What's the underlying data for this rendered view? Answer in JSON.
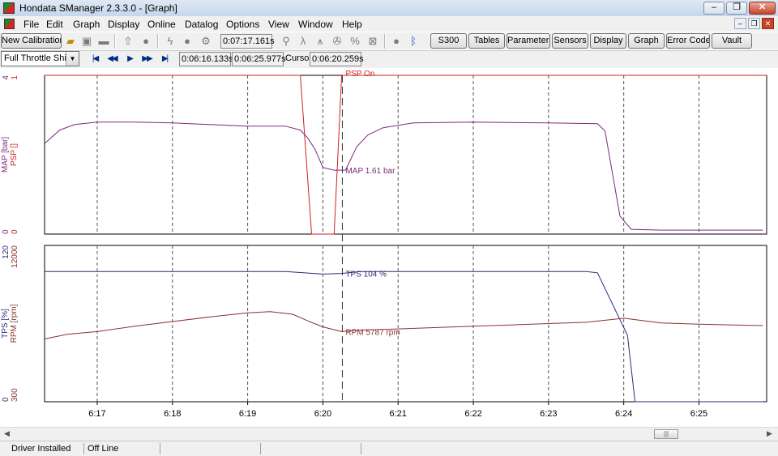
{
  "window": {
    "title": "Hondata SManager 2.3.3.0 - [Graph]"
  },
  "menu": [
    "File",
    "Edit",
    "Graph",
    "Display",
    "Online",
    "Datalog",
    "Options",
    "View",
    "Window",
    "Help"
  ],
  "toolbar1": {
    "new_calibration": "New Calibration",
    "elapsed": "0:07:17.161s",
    "buttons": [
      "S300",
      "Tables",
      "Parameters",
      "Sensors",
      "Display",
      "Graph",
      "Error Codes",
      "Vault"
    ]
  },
  "toolbar2": {
    "preset": "Full Throttle Shift",
    "start_time": "0:06:16.133s",
    "end_time": "0:06:25.977s",
    "cursor_label": "Cursor",
    "cursor_time": "0:06:20.259s"
  },
  "statusbar": [
    "Driver Installed",
    "Off Line"
  ],
  "colors": {
    "psp": "#cc2222",
    "map": "#7a2a7a",
    "tps": "#2b2b7a",
    "rpm": "#8a3030",
    "grid": "#555555"
  },
  "chart_data": {
    "type": "line",
    "x_unit": "time (m:ss)",
    "xlim": [
      6.163,
      6.259
    ],
    "x_ticks": [
      "6:17",
      "6:18",
      "6:19",
      "6:20",
      "6:21",
      "6:22",
      "6:23",
      "6:24",
      "6:25"
    ],
    "cursor_x": "6:20.259",
    "panels": [
      {
        "name": "top",
        "axes": [
          {
            "label": "PSP []",
            "range": [
              0,
              1
            ],
            "ticks": [
              "0",
              "1"
            ],
            "color": "#cc2222"
          },
          {
            "label": "MAP [bar]",
            "range": [
              0,
              4
            ],
            "ticks": [
              "0",
              "4"
            ],
            "color": "#7a2a7a"
          }
        ],
        "series": [
          {
            "name": "PSP",
            "readout": "PSP On",
            "color": "#cc2222",
            "points": [
              [
                6.163,
                1
              ],
              [
                6.197,
                1
              ],
              [
                6.1985,
                0
              ],
              [
                6.2015,
                0
              ],
              [
                6.2025,
                1
              ],
              [
                6.259,
                1
              ]
            ]
          },
          {
            "name": "MAP",
            "readout": "MAP 1.61 bar",
            "color": "#7a2a7a",
            "points": [
              [
                6.163,
                2.28
              ],
              [
                6.165,
                2.62
              ],
              [
                6.167,
                2.76
              ],
              [
                6.17,
                2.82
              ],
              [
                6.175,
                2.82
              ],
              [
                6.18,
                2.8
              ],
              [
                6.185,
                2.76
              ],
              [
                6.19,
                2.72
              ],
              [
                6.195,
                2.72
              ],
              [
                6.197,
                2.62
              ],
              [
                6.198,
                2.42
              ],
              [
                6.199,
                2.12
              ],
              [
                6.2,
                1.68
              ],
              [
                6.2015,
                1.61
              ],
              [
                6.203,
                1.61
              ],
              [
                6.2045,
                2.2
              ],
              [
                6.206,
                2.5
              ],
              [
                6.208,
                2.68
              ],
              [
                6.212,
                2.8
              ],
              [
                6.22,
                2.82
              ],
              [
                6.23,
                2.8
              ],
              [
                6.2365,
                2.78
              ],
              [
                6.2375,
                2.6
              ],
              [
                6.2395,
                0.45
              ],
              [
                6.241,
                0.12
              ],
              [
                6.245,
                0.1
              ],
              [
                6.2585,
                0.1
              ]
            ]
          }
        ]
      },
      {
        "name": "bottom",
        "axes": [
          {
            "label": "RPM [rpm]",
            "range": [
              300,
              12000
            ],
            "ticks": [
              "300",
              "12000"
            ],
            "color": "#8a3030"
          },
          {
            "label": "TPS [%]",
            "range": [
              0,
              120
            ],
            "ticks": [
              "0",
              "120"
            ],
            "color": "#2b2b7a"
          }
        ],
        "series": [
          {
            "name": "TPS",
            "readout": "TPS 104 %",
            "color": "#2b2b7a",
            "points": [
              [
                6.163,
                100
              ],
              [
                6.195,
                100
              ],
              [
                6.2,
                98
              ],
              [
                6.2025,
                98.5
              ],
              [
                6.205,
                100
              ],
              [
                6.235,
                100
              ],
              [
                6.2365,
                99
              ],
              [
                6.2405,
                51
              ],
              [
                6.2415,
                0
              ],
              [
                6.2585,
                0
              ]
            ]
          },
          {
            "name": "RPM",
            "readout": "RPM 5787 rpm",
            "color": "#8a3030",
            "points": [
              [
                6.163,
                5000
              ],
              [
                6.166,
                5350
              ],
              [
                6.17,
                5550
              ],
              [
                6.175,
                5950
              ],
              [
                6.18,
                6300
              ],
              [
                6.185,
                6650
              ],
              [
                6.19,
                6950
              ],
              [
                6.193,
                7050
              ],
              [
                6.196,
                6850
              ],
              [
                6.198,
                6350
              ],
              [
                6.2,
                5900
              ],
              [
                6.2025,
                5550
              ],
              [
                6.2045,
                5650
              ],
              [
                6.21,
                5750
              ],
              [
                6.22,
                5950
              ],
              [
                6.23,
                6150
              ],
              [
                6.235,
                6250
              ],
              [
                6.24,
                6550
              ],
              [
                6.2415,
                6450
              ],
              [
                6.245,
                6200
              ],
              [
                6.25,
                6100
              ],
              [
                6.2585,
                6000
              ]
            ]
          }
        ]
      }
    ]
  }
}
